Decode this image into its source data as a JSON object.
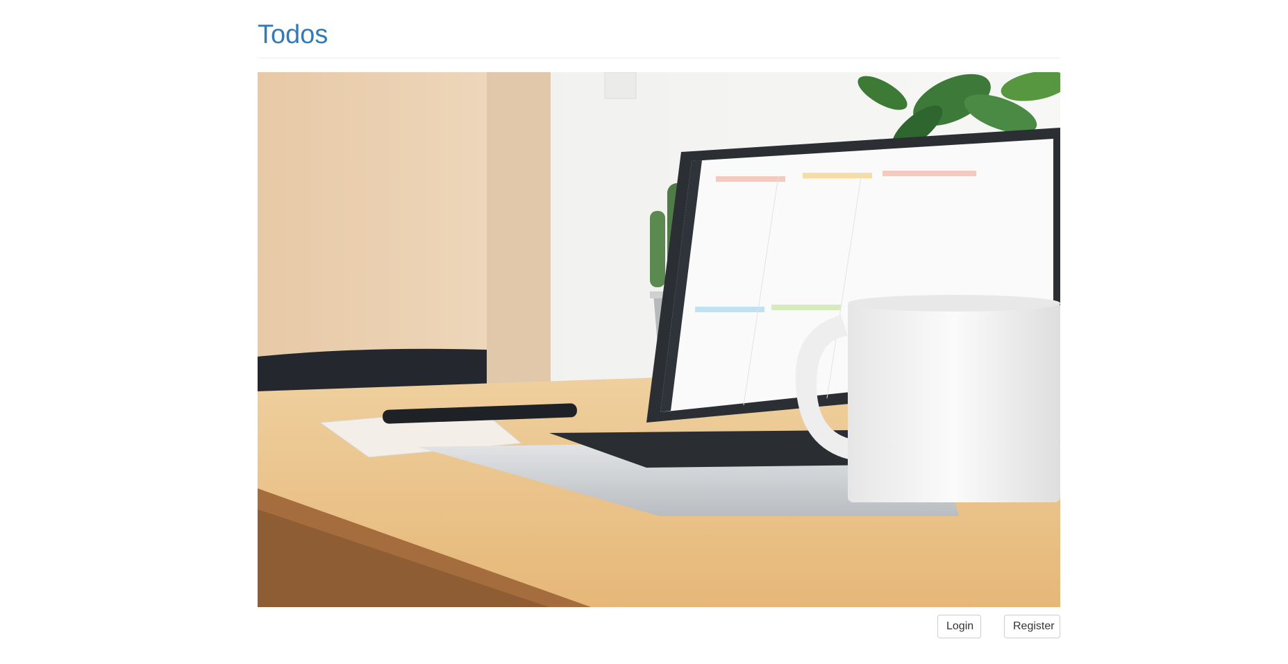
{
  "page": {
    "title": "Todos",
    "title_color": "#337ab7"
  },
  "hero": {
    "description_icon": "laptop-desk-photo",
    "colors": {
      "wall": "#f3f3f1",
      "wood_panel": "#e8cfae",
      "desk": "#e9c18a",
      "desk_edge": "#9b6a3c",
      "chair": "#24282e",
      "laptop_body": "#d9dbde",
      "screen_bezel": "#2b2e33",
      "mug": "#f5f5f5",
      "plant": "#3f7a3d"
    }
  },
  "buttons": {
    "login_label": "Login",
    "register_label": "Register"
  }
}
